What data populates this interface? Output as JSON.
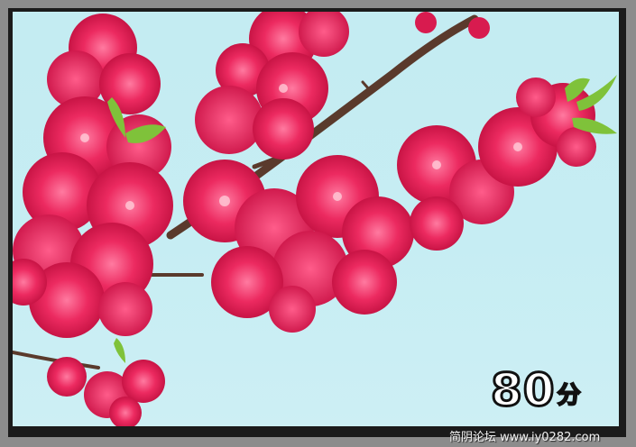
{
  "photo": {
    "subject": "peach-blossom-icon",
    "sky_color": "#c6edf3",
    "blossom_color": "#e8225a",
    "branch_color": "#5a3a2c",
    "leaf_color": "#7fc23a"
  },
  "overlay": {
    "score_value": "80",
    "score_unit": "分"
  },
  "watermark": {
    "text": "简阴论坛 www.iy0282.com"
  }
}
